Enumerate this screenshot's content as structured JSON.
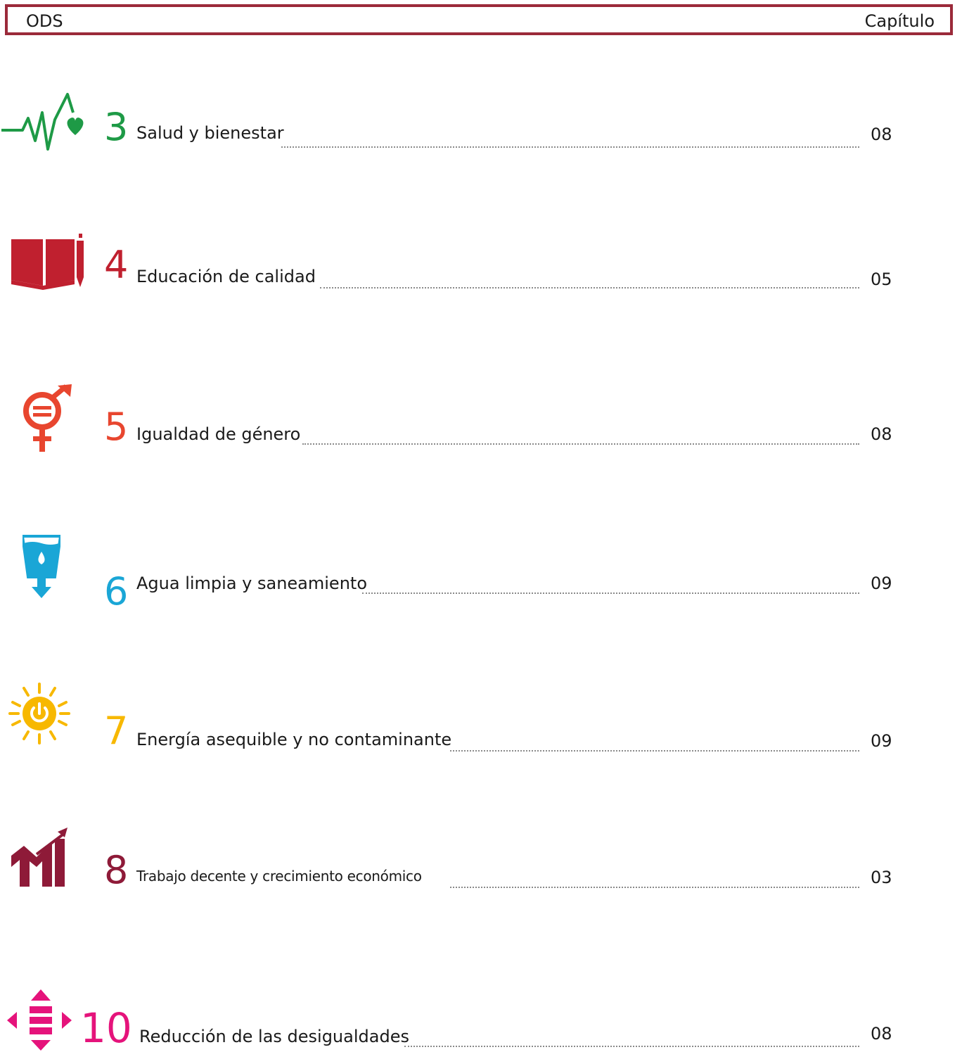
{
  "header": {
    "left": "ODS",
    "right": "Capítulo"
  },
  "items": [
    {
      "number": "3",
      "label": "Salud y bienestar",
      "chapter": "08",
      "color": "#1e9a46",
      "icon": "health-heartbeat-icon"
    },
    {
      "number": "4",
      "label": "Educación de calidad",
      "chapter": "05",
      "color": "#c0202f",
      "icon": "book-pencil-icon"
    },
    {
      "number": "5",
      "label": "Igualdad de género",
      "chapter": "08",
      "color": "#e8462f",
      "icon": "gender-equality-icon"
    },
    {
      "number": "6",
      "label": "Agua limpia y saneamiento",
      "chapter": "09",
      "color": "#1aa6d6",
      "icon": "water-glass-icon"
    },
    {
      "number": "7",
      "label": "Energía asequible y no contaminante",
      "chapter": "09",
      "color": "#f7b800",
      "icon": "sun-power-icon"
    },
    {
      "number": "8",
      "label": "Trabajo decente y crecimiento económico",
      "chapter": "03",
      "color": "#8e1a38",
      "icon": "growth-chart-icon"
    },
    {
      "number": "10",
      "label": "Reducción de las desigualdades",
      "chapter": "08",
      "color": "#e5137b",
      "icon": "reduced-inequality-icon"
    }
  ]
}
